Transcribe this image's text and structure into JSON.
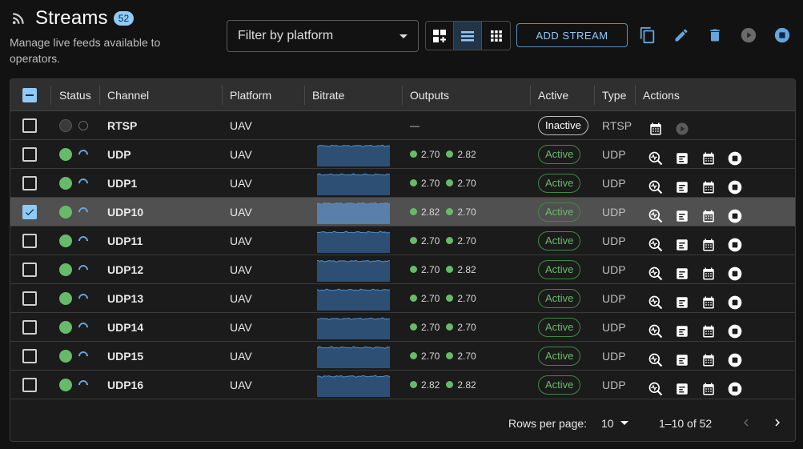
{
  "header": {
    "title": "Streams",
    "count": "52",
    "subtitle": "Manage live feeds available to operators.",
    "filter_placeholder": "Filter by platform",
    "add_button": "ADD STREAM"
  },
  "table": {
    "columns": [
      "Status",
      "Channel",
      "Platform",
      "Bitrate",
      "Outputs",
      "Active",
      "Type",
      "Actions"
    ],
    "rows": [
      {
        "channel": "RTSP",
        "platform": "UAV",
        "outputs": [
          "—"
        ],
        "active": "Inactive",
        "type": "RTSP",
        "online": false,
        "selected": false
      },
      {
        "channel": "UDP",
        "platform": "UAV",
        "outputs": [
          "2.70",
          "2.82"
        ],
        "active": "Active",
        "type": "UDP",
        "online": true,
        "selected": false
      },
      {
        "channel": "UDP1",
        "platform": "UAV",
        "outputs": [
          "2.70",
          "2.70"
        ],
        "active": "Active",
        "type": "UDP",
        "online": true,
        "selected": false
      },
      {
        "channel": "UDP10",
        "platform": "UAV",
        "outputs": [
          "2.82",
          "2.70"
        ],
        "active": "Active",
        "type": "UDP",
        "online": true,
        "selected": true
      },
      {
        "channel": "UDP11",
        "platform": "UAV",
        "outputs": [
          "2.70",
          "2.70"
        ],
        "active": "Active",
        "type": "UDP",
        "online": true,
        "selected": false
      },
      {
        "channel": "UDP12",
        "platform": "UAV",
        "outputs": [
          "2.70",
          "2.82"
        ],
        "active": "Active",
        "type": "UDP",
        "online": true,
        "selected": false
      },
      {
        "channel": "UDP13",
        "platform": "UAV",
        "outputs": [
          "2.70",
          "2.70"
        ],
        "active": "Active",
        "type": "UDP",
        "online": true,
        "selected": false
      },
      {
        "channel": "UDP14",
        "platform": "UAV",
        "outputs": [
          "2.70",
          "2.70"
        ],
        "active": "Active",
        "type": "UDP",
        "online": true,
        "selected": false
      },
      {
        "channel": "UDP15",
        "platform": "UAV",
        "outputs": [
          "2.70",
          "2.70"
        ],
        "active": "Active",
        "type": "UDP",
        "online": true,
        "selected": false
      },
      {
        "channel": "UDP16",
        "platform": "UAV",
        "outputs": [
          "2.82",
          "2.82"
        ],
        "active": "Active",
        "type": "UDP",
        "online": true,
        "selected": false
      }
    ]
  },
  "pagination": {
    "rows_per_page_label": "Rows per page:",
    "rows_per_page": "10",
    "range": "1–10 of 52"
  },
  "colors": {
    "accent": "#90caf9",
    "active_green": "#66bb6a",
    "background": "#121212"
  },
  "icons": [
    "rss-icon",
    "grid-add-icon",
    "list-icon",
    "grid-icon",
    "copy-icon",
    "edit-icon",
    "delete-icon",
    "play-icon",
    "stop-icon",
    "calendar-icon",
    "inspect-icon",
    "log-icon",
    "chevron-left-icon",
    "chevron-right-icon"
  ]
}
